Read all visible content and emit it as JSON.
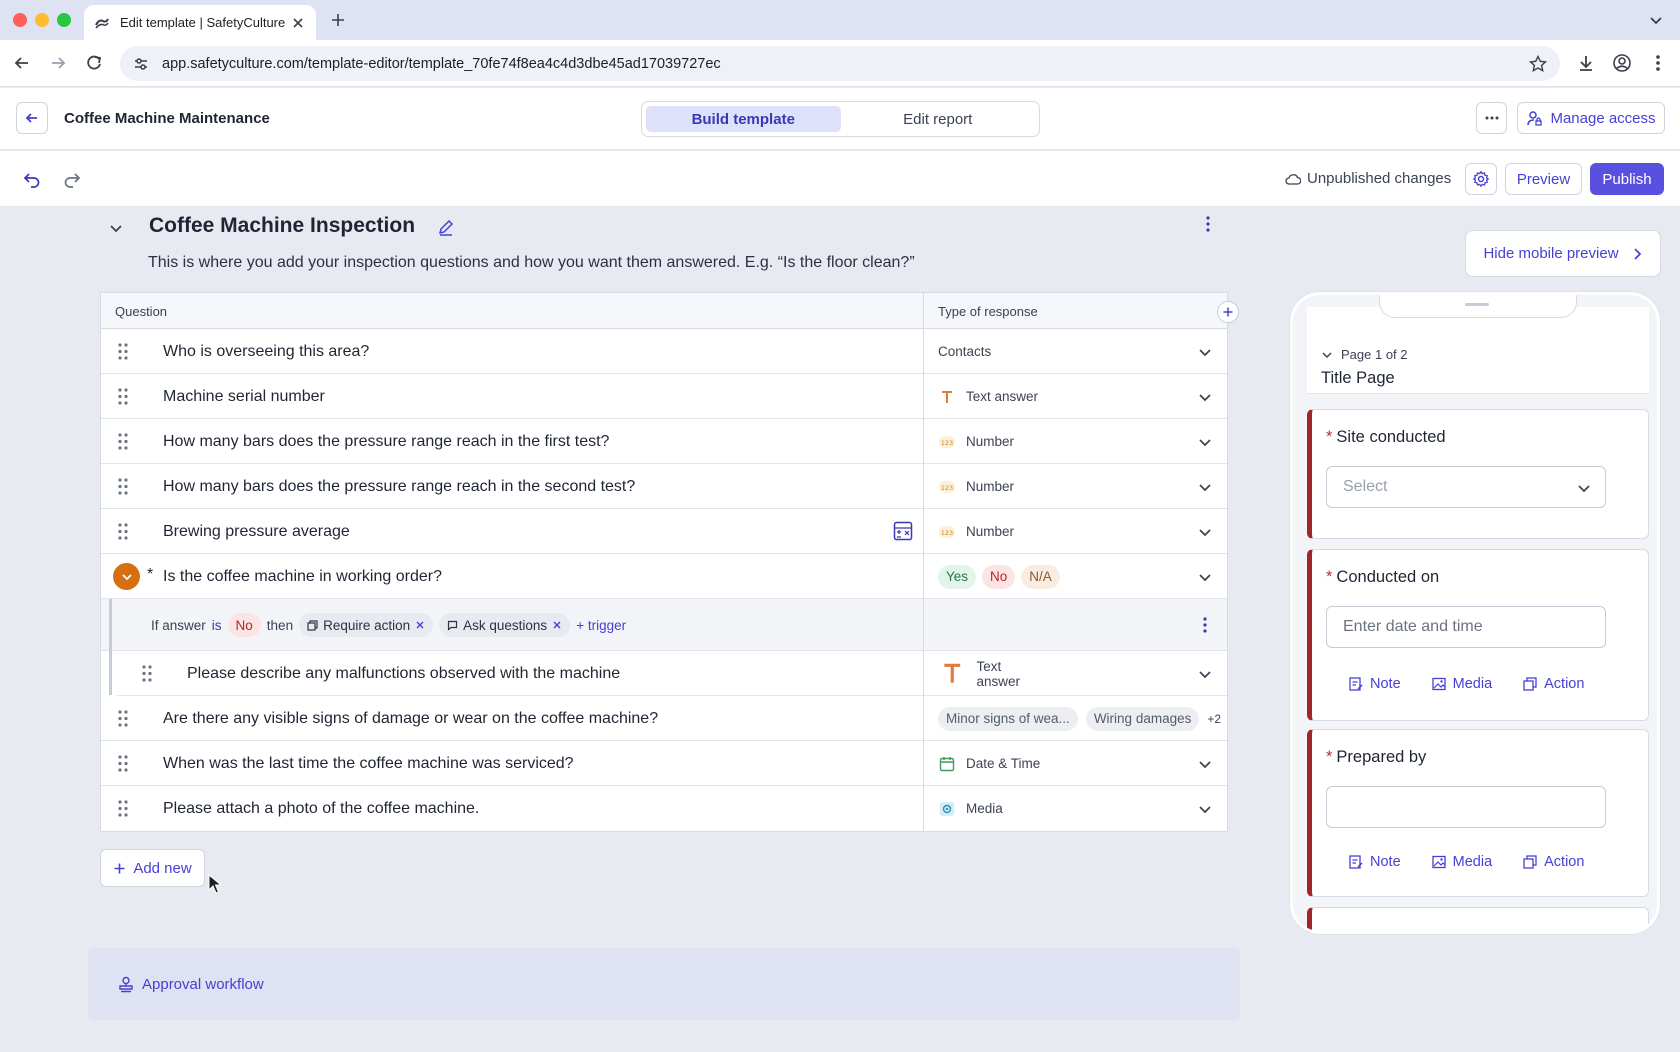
{
  "browser": {
    "tab_title": "Edit template | SafetyCulture",
    "url": "app.safetyculture.com/template-editor/template_70fe74f8ea4c4d3dbe45ad17039727ec"
  },
  "header": {
    "template_name": "Coffee Machine Maintenance",
    "mode_tabs": [
      "Build template",
      "Edit report"
    ],
    "active_mode": "Build template",
    "manage_access": "Manage access"
  },
  "toolbar": {
    "status": "Unpublished changes",
    "preview": "Preview",
    "publish": "Publish"
  },
  "section": {
    "title": "Coffee Machine Inspection",
    "description": "This is where you add your inspection questions and how you want them answered. E.g. “Is the floor clean?”"
  },
  "table": {
    "col_question": "Question",
    "col_response": "Type of response",
    "rows": [
      {
        "question": "Who is overseeing this area?",
        "response": "Contacts",
        "icon": "none"
      },
      {
        "question": "Machine serial number",
        "response": "Text answer",
        "icon": "text-icon"
      },
      {
        "question": "How many bars does the pressure range reach in the first test?",
        "response": "Number",
        "icon": "number-icon"
      },
      {
        "question": "How many bars does the pressure range reach in the second test?",
        "response": "Number",
        "icon": "number-icon"
      },
      {
        "question": "Brewing pressure average",
        "response": "Number",
        "icon": "number-icon"
      },
      {
        "question": "Is the coffee machine in working order?",
        "required": "*",
        "chips": [
          "Yes",
          "No",
          "N/A"
        ]
      },
      {
        "question": "Are there any visible signs of damage or wear on the coffee machine?",
        "chips": [
          "Minor signs of wea...",
          "Wiring damages"
        ],
        "more": "+2"
      },
      {
        "question": "When was the last time the coffee machine was serviced?",
        "response": "Date & Time",
        "icon": "calendar-icon"
      },
      {
        "question": "Please attach a photo of the coffee machine.",
        "response": "Media",
        "icon": "media-icon"
      }
    ],
    "logic": {
      "if_answer": "If answer",
      "is": "is",
      "value": "No",
      "then": "then",
      "actions": [
        "Require action",
        "Ask questions"
      ],
      "add_trigger": "+ trigger"
    },
    "sub_question": {
      "question": "Please describe any malfunctions observed with the machine",
      "response": "Text answer"
    }
  },
  "add_new": "Add new",
  "approval": "Approval workflow",
  "mobile": {
    "hide_preview": "Hide mobile preview",
    "page_indicator": "Page 1 of 2",
    "page_title": "Title Page",
    "fields": [
      {
        "label": "Site conducted",
        "placeholder": "Select"
      },
      {
        "label": "Conducted on",
        "placeholder": "Enter date and time"
      },
      {
        "label": "Prepared by",
        "placeholder": ""
      }
    ],
    "actions": [
      "Note",
      "Media",
      "Action"
    ]
  },
  "colors": {
    "accent": "#5a50e0",
    "required": "#a0262c",
    "warning": "#d66f12"
  }
}
